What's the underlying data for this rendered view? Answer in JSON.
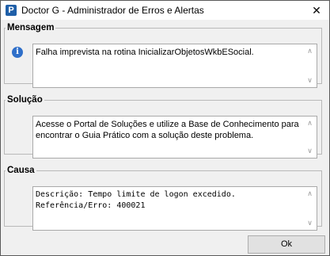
{
  "window": {
    "title": "Doctor G - Administrador de Erros e Alertas",
    "app_icon_glyph": "P",
    "close_glyph": "✕"
  },
  "sections": {
    "mensagem": {
      "label": "Mensagem",
      "icon": "info-icon",
      "icon_glyph": "i",
      "text": "Falha imprevista na rotina InicializarObjetosWkbESocial."
    },
    "solucao": {
      "label": "Solução",
      "text": "Acesse o Portal de Soluções e utilize a Base de Conhecimento para encontrar o Guia Prático com a solução deste problema."
    },
    "causa": {
      "label": "Causa",
      "text": "Descrição: Tempo limite de logon excedido.\nReferência/Erro: 400021"
    }
  },
  "scroll": {
    "up_glyph": "∧",
    "down_glyph": "∨"
  },
  "buttons": {
    "ok_label": "Ok"
  }
}
